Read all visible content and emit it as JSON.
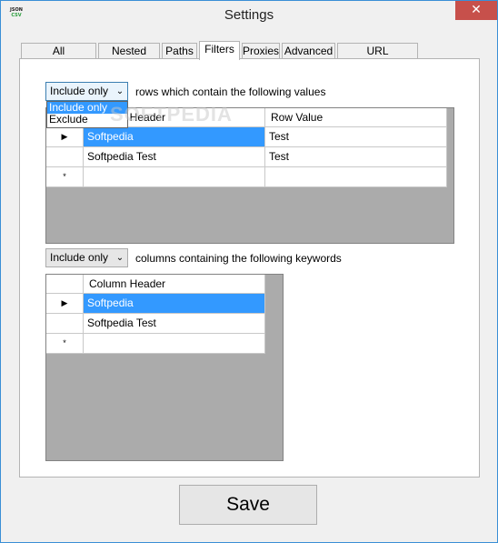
{
  "window": {
    "title": "Settings",
    "icon_top": "JSON",
    "icon_bottom": "CSV",
    "close_glyph": "✕"
  },
  "tabs": [
    {
      "label": "All Conversions"
    },
    {
      "label": "Nested Data"
    },
    {
      "label": "Paths"
    },
    {
      "label": "Filters",
      "active": true
    },
    {
      "label": "Proxies"
    },
    {
      "label": "Advanced"
    },
    {
      "label": "URL conversions"
    }
  ],
  "row_filter": {
    "mode_value": "Include only",
    "label": "rows which contain the following values",
    "dropdown_open": true,
    "options": [
      "Include only",
      "Exclude"
    ],
    "highlighted_option": "Include only",
    "columns": [
      "Column Header",
      "Row Value"
    ],
    "rows": [
      {
        "marker": "▶",
        "col1": "Softpedia",
        "col2": "Test",
        "selected_col1": true
      },
      {
        "marker": "",
        "col1": "Softpedia Test",
        "col2": "Test"
      },
      {
        "marker": "*",
        "col1": "",
        "col2": ""
      }
    ]
  },
  "column_filter": {
    "mode_value": "Include only",
    "label": "columns containing the following keywords",
    "columns": [
      "Column Header"
    ],
    "rows": [
      {
        "marker": "▶",
        "col1": "Softpedia",
        "selected_col1": true
      },
      {
        "marker": "",
        "col1": "Softpedia Test"
      },
      {
        "marker": "*",
        "col1": ""
      }
    ]
  },
  "save_label": "Save",
  "watermark": "SOFTPEDIA",
  "colors": {
    "selection": "#3399ff",
    "grid_background": "#ababab",
    "close_button": "#c7504b"
  }
}
